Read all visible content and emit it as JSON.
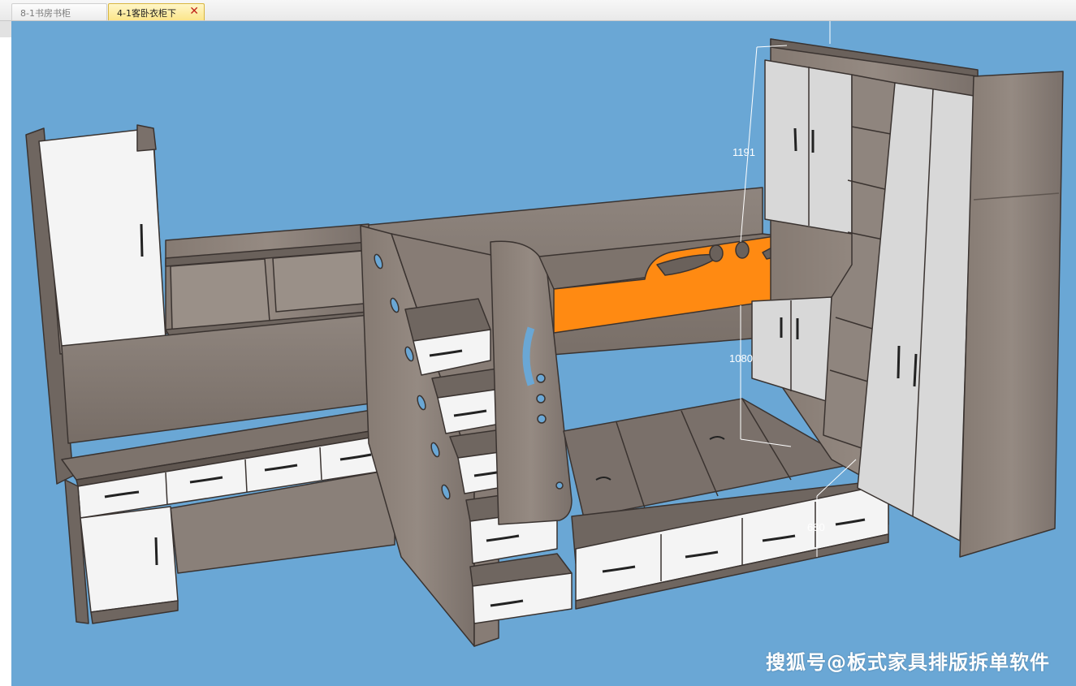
{
  "tabs": [
    {
      "label": "8-1书房书柜",
      "active": false
    },
    {
      "label": "4-1客卧衣柜下",
      "active": true,
      "close": "✕"
    }
  ],
  "viewport": {
    "background": "#6aa7d5",
    "dimensions": [
      "1191",
      "1080",
      "680"
    ]
  },
  "colors": {
    "wood_dark": "#7a706a",
    "wood_mid": "#8d837c",
    "white_panel": "#f4f4f4",
    "orange_rail": "#ff8a12",
    "edge": "#3a3330"
  },
  "watermark": "搜狐号@板式家具排版拆单软件"
}
